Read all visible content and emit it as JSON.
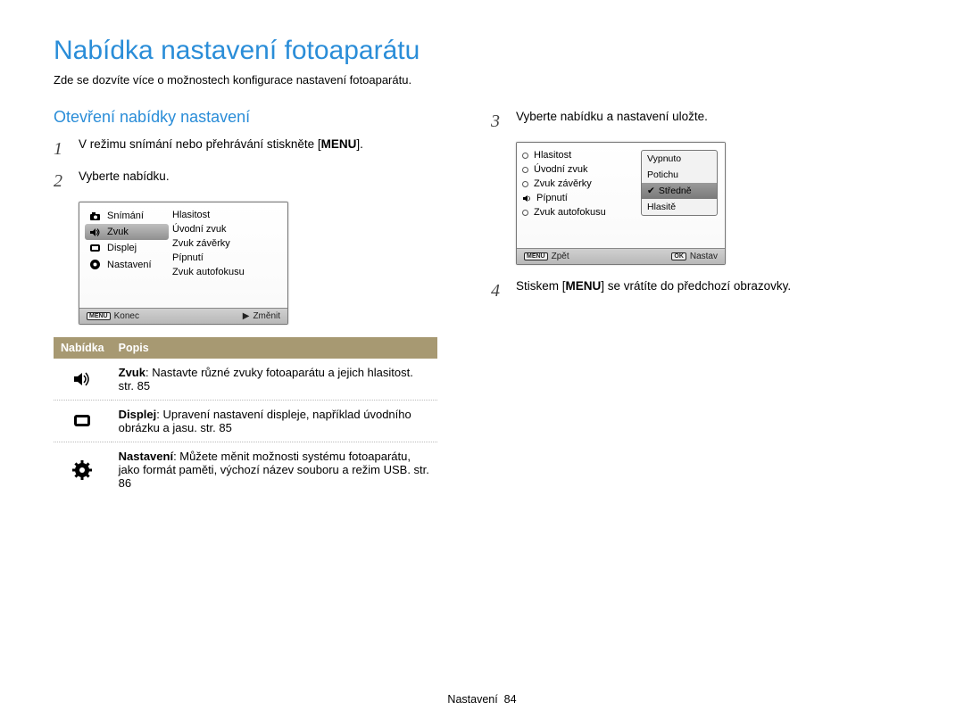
{
  "page_title": "Nabídka nastavení fotoaparátu",
  "intro": "Zde se dozvíte více o možnostech konfigurace nastavení fotoaparátu.",
  "section_title": "Otevření nabídky nastavení",
  "steps": {
    "1_pre": "V režimu snímání nebo přehrávání stiskněte [",
    "1_btn": "MENU",
    "1_post": "].",
    "2": "Vyberte nabídku.",
    "3": "Vyberte nabídku a nastavení uložte.",
    "4_pre": "Stiskem [",
    "4_btn": "MENU",
    "4_post": "] se vrátíte do předchozí obrazovky."
  },
  "lcd1": {
    "left": [
      "Snímání",
      "Zvuk",
      "Displej",
      "Nastavení"
    ],
    "selected_index": 1,
    "right": [
      "Hlasitost",
      "Úvodní zvuk",
      "Zvuk závěrky",
      "Pípnutí",
      "Zvuk autofokusu"
    ],
    "bar_left": "Konec",
    "bar_right": "Změnit"
  },
  "lcd2": {
    "options": [
      "Hlasitost",
      "Úvodní zvuk",
      "Zvuk závěrky",
      "Pípnutí",
      "Zvuk autofokusu"
    ],
    "popup": [
      "Vypnuto",
      "Potichu",
      "Středně",
      "Hlasitě"
    ],
    "popup_selected": 2,
    "bar_left": "Zpět",
    "bar_right": "Nastav"
  },
  "table": {
    "h1": "Nabídka",
    "h2": "Popis",
    "rows": [
      {
        "label": "Zvuk",
        "text": ": Nastavte různé zvuky fotoaparátu a jejich hlasitost. str. 85"
      },
      {
        "label": "Displej",
        "text": ": Upravení nastavení displeje, například úvodního obrázku a jasu. str. 85"
      },
      {
        "label": "Nastavení",
        "text": ": Můžete měnit možnosti systému fotoaparátu, jako formát paměti, výchozí název souboru a režim USB. str. 86"
      }
    ]
  },
  "footer_label": "Nastavení",
  "footer_page": "84",
  "btn": {
    "menu": "MENU",
    "ok": "OK"
  }
}
